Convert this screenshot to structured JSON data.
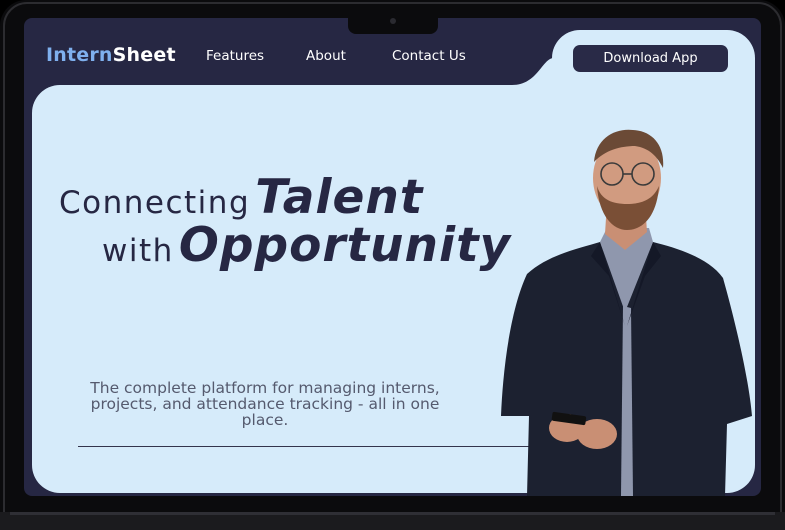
{
  "brand": {
    "part1": "Intern",
    "part2": "Sheet"
  },
  "nav": {
    "features": "Features",
    "about": "About",
    "contact": "Contact Us",
    "download": "Download App"
  },
  "hero": {
    "line1_light": "Connecting",
    "line1_bold": "Talent",
    "line2_light": "with",
    "line2_bold": "Opportunity",
    "tagline": "The complete platform for managing interns, projects, and attendance tracking - all in one place."
  },
  "colors": {
    "navy": "#262743",
    "hero_bg": "#d6ebfa",
    "brand_accent": "#7fb0ee"
  }
}
